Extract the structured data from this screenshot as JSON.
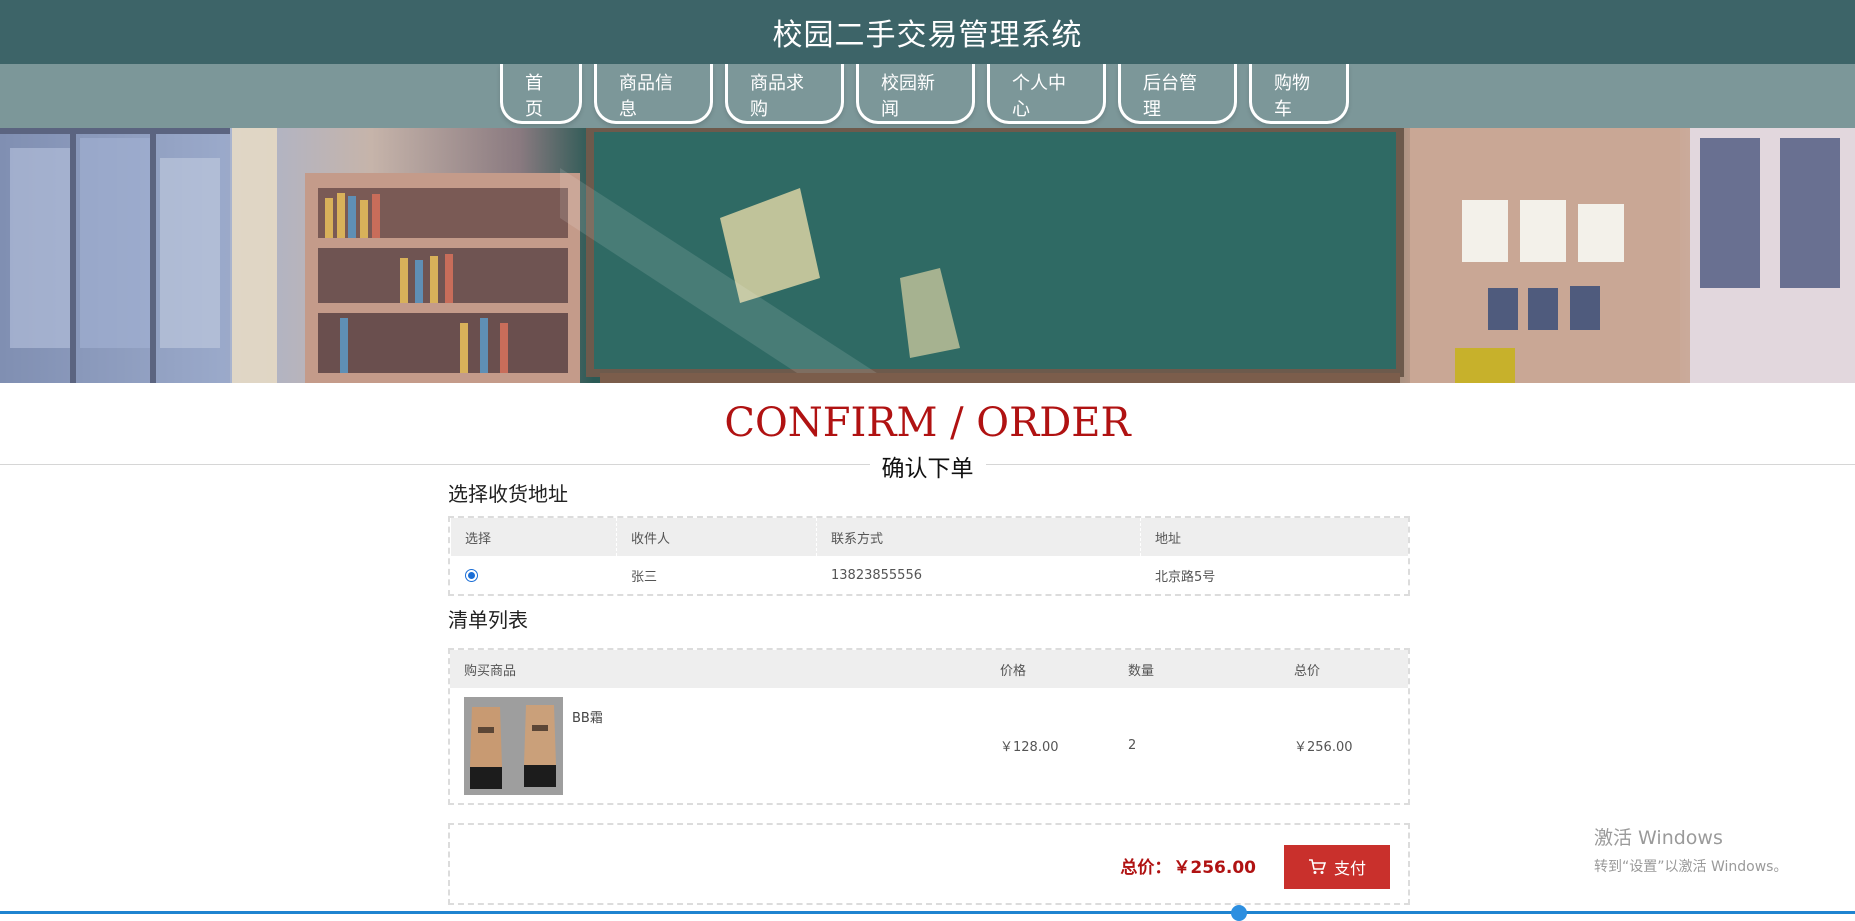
{
  "header": {
    "title": "校园二手交易管理系统"
  },
  "nav": {
    "items": [
      "首页",
      "商品信息",
      "商品求购",
      "校园新闻",
      "个人中心",
      "后台管理",
      "购物车"
    ]
  },
  "section": {
    "title_en": "CONFIRM / ORDER",
    "title_cn": "确认下单"
  },
  "address": {
    "title": "选择收货地址",
    "columns": [
      "选择",
      "收件人",
      "联系方式",
      "地址"
    ],
    "rows": [
      {
        "recipient": "张三",
        "phone": "13823855556",
        "address": "北京路5号"
      }
    ]
  },
  "list": {
    "title": "清单列表",
    "columns": [
      "购买商品",
      "价格",
      "数量",
      "总价"
    ],
    "rows": [
      {
        "name": "BB霜",
        "price": "￥128.00",
        "quantity": "2",
        "total": "￥256.00"
      }
    ]
  },
  "summary": {
    "total_label": "总价：",
    "total_value": "￥256.00",
    "pay_label": "支付"
  },
  "watermark": {
    "line1": "激活 Windows",
    "line2": "转到“设置”以激活 Windows。"
  },
  "colors": {
    "header": "#3d6468",
    "nav": "#7c9799",
    "accent": "#b01212",
    "pay_button": "#c9302c"
  },
  "icons": {
    "pay": "cart-icon"
  }
}
